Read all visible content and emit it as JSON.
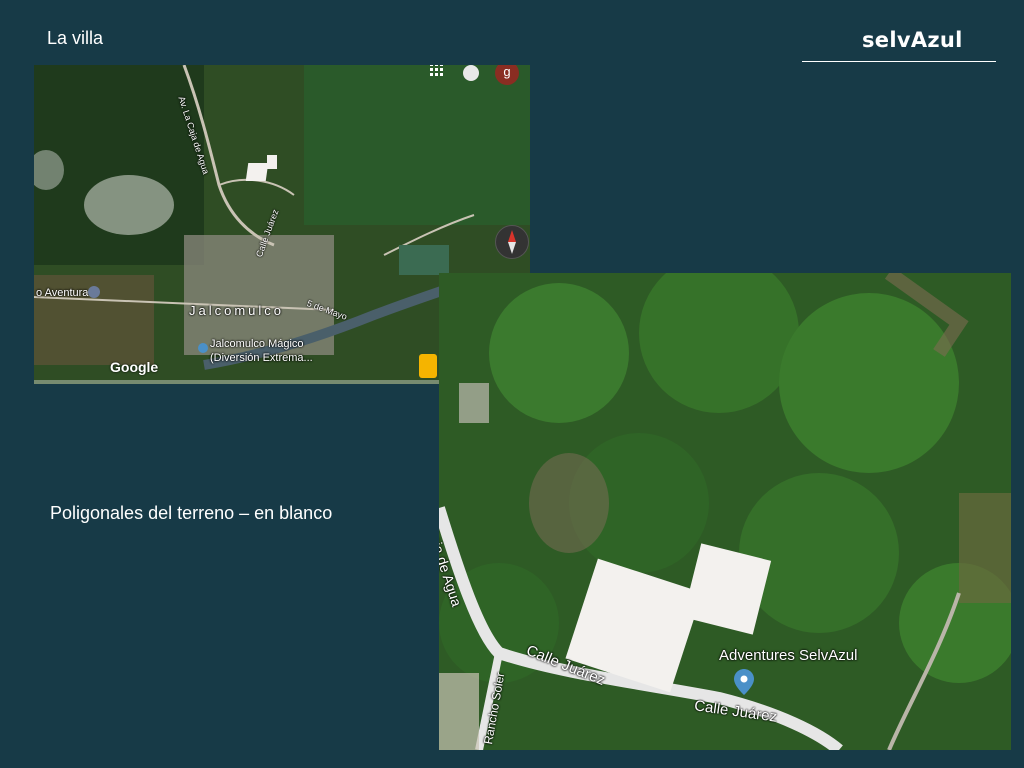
{
  "slide": {
    "title": "La villa",
    "brand": "selvAzul",
    "caption": "Poligonales del terreno – en  blanco"
  },
  "map_small": {
    "labels": {
      "street_agua": "Av. La Caja de Agua",
      "aventura": "o Aventura",
      "town": "Jalcomulco",
      "calle_juarez": "Calle Juárez",
      "cinco_mayo": "5 de Mayo",
      "poi_name": "Jalcomulco Mágico",
      "poi_sub": "(Diversión Extrema..."
    },
    "avatar_letter": "g",
    "google": "Google",
    "icons": [
      "apps-icon",
      "bell-icon",
      "compass-icon",
      "pegman-icon",
      "map-pin-icon"
    ]
  },
  "map_large": {
    "labels": {
      "street_agua": "La Caja de Agua",
      "calle_juarez_1": "Calle Juárez",
      "calle_juarez_2": "Calle Juárez",
      "rancho_soler": "Rancho Soler",
      "adventures": "Adventures SelvAzul"
    },
    "icons": [
      "map-pin-icon"
    ]
  },
  "colors": {
    "background": "#173a47",
    "polygon": "#f3f1ee",
    "pin": "#4a90c8"
  }
}
